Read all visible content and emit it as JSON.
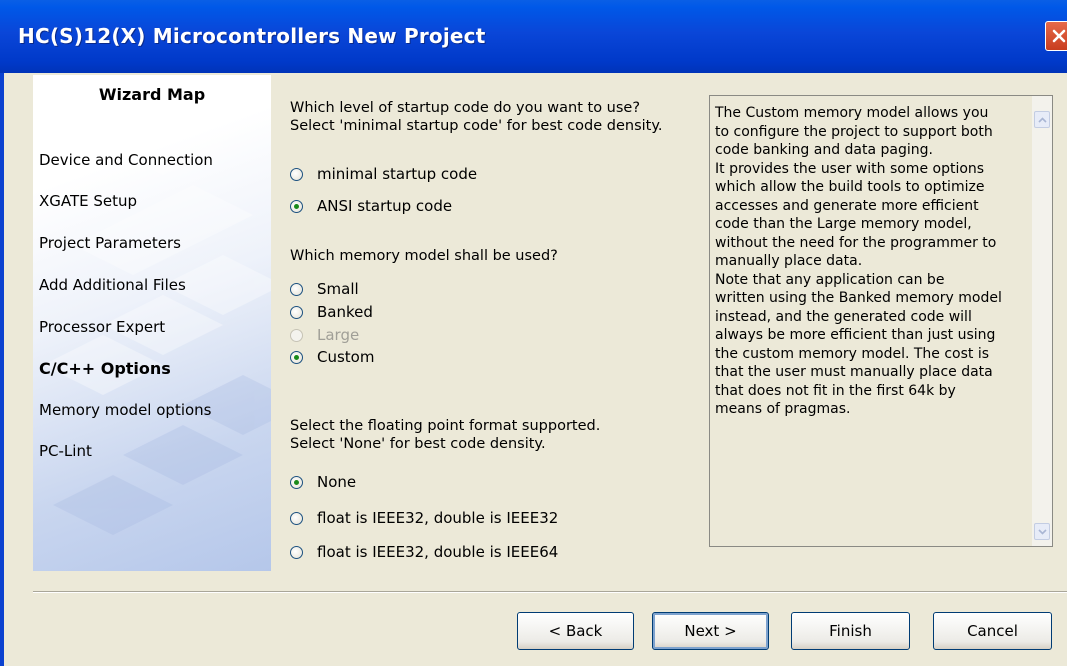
{
  "window": {
    "title": "HC(S)12(X) Microcontrollers New Project"
  },
  "wizard_map": {
    "title": "Wizard Map",
    "items": [
      {
        "label": "Device and Connection",
        "active": false
      },
      {
        "label": "XGATE Setup",
        "active": false
      },
      {
        "label": "Project Parameters",
        "active": false
      },
      {
        "label": "Add Additional Files",
        "active": false
      },
      {
        "label": "Processor Expert",
        "active": false
      },
      {
        "label": "C/C++ Options",
        "active": true
      },
      {
        "label": "Memory model options",
        "active": false
      },
      {
        "label": "PC-Lint",
        "active": false
      }
    ]
  },
  "startup": {
    "question_line1": "Which level of startup code do you want to use?",
    "question_line2": "Select 'minimal startup code' for best code density.",
    "options": [
      {
        "label": "minimal startup code",
        "checked": false,
        "enabled": true
      },
      {
        "label": "ANSI startup code",
        "checked": true,
        "enabled": true
      }
    ]
  },
  "memory_model": {
    "question": "Which memory model shall be used?",
    "options": [
      {
        "label": "Small",
        "checked": false,
        "enabled": true
      },
      {
        "label": "Banked",
        "checked": false,
        "enabled": true
      },
      {
        "label": "Large",
        "checked": false,
        "enabled": false
      },
      {
        "label": "Custom",
        "checked": true,
        "enabled": true
      }
    ]
  },
  "floating_point": {
    "question_line1": "Select the floating point format supported.",
    "question_line2": "Select 'None' for best code density.",
    "options": [
      {
        "label": "None",
        "checked": true,
        "enabled": true
      },
      {
        "label": "float is IEEE32, double is IEEE32",
        "checked": false,
        "enabled": true
      },
      {
        "label": "float is IEEE32, double is IEEE64",
        "checked": false,
        "enabled": true
      }
    ]
  },
  "description": {
    "text": "The Custom memory model allows you\nto configure the project to support both\ncode banking and data paging.\nIt provides the user with some options\nwhich allow the build tools to optimize\naccesses and generate more efficient\ncode than the Large memory model,\nwithout the need for the programmer to\nmanually place data.\nNote that any application can be\nwritten using the Banked memory model\ninstead, and the generated code will\nalways be more efficient than just using\nthe custom memory model. The cost is\nthat the user must manually place data\nthat does not fit in the first 64k by\nmeans of pragmas."
  },
  "buttons": {
    "back": "< Back",
    "next": "Next >",
    "finish": "Finish",
    "cancel": "Cancel"
  },
  "colors": {
    "title_bar": "#0a46d8",
    "dialog_bg": "#ece9d8",
    "close_button": "#d2502f",
    "radio_dot": "#1a8a1a"
  },
  "icons": {
    "close": "close-icon",
    "scroll_up": "arrow-up-icon",
    "scroll_down": "arrow-down-icon"
  }
}
